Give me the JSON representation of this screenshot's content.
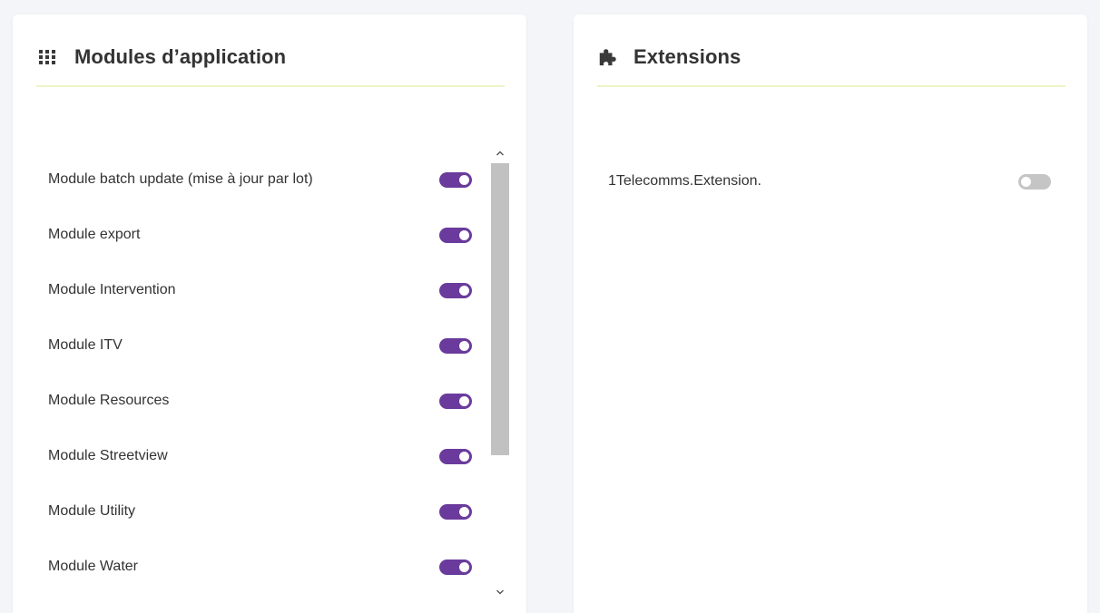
{
  "colors": {
    "toggle_on": "#6a3b9c",
    "toggle_off": "#c5c5c5",
    "header_underline": "#eef3c7"
  },
  "modules_panel": {
    "title": "Modules d’application",
    "icon": "grid-icon",
    "items": [
      {
        "label": "Module batch update (mise à jour par lot)",
        "enabled": true
      },
      {
        "label": "Module export",
        "enabled": true
      },
      {
        "label": "Module Intervention",
        "enabled": true
      },
      {
        "label": "Module ITV",
        "enabled": true
      },
      {
        "label": "Module Resources",
        "enabled": true
      },
      {
        "label": "Module Streetview",
        "enabled": true
      },
      {
        "label": "Module Utility",
        "enabled": true
      },
      {
        "label": "Module Water",
        "enabled": true
      }
    ]
  },
  "extensions_panel": {
    "title": "Extensions",
    "icon": "puzzle-icon",
    "items": [
      {
        "label": "1Telecomms.Extension.",
        "enabled": false
      }
    ]
  }
}
